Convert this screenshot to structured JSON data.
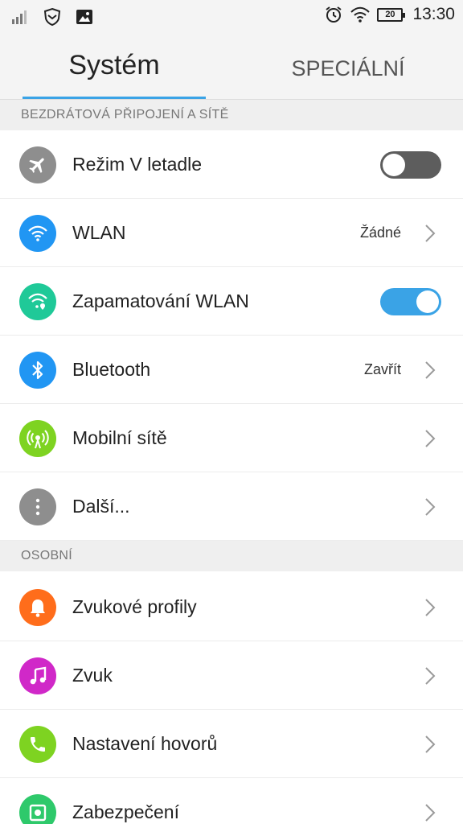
{
  "status_bar": {
    "time": "13:30",
    "battery": "20",
    "icons": [
      "signal-icon",
      "shield-icon",
      "image-icon",
      "alarm-icon",
      "wifi-icon",
      "battery-icon"
    ]
  },
  "tabs": [
    {
      "label": "Systém",
      "active": true
    },
    {
      "label": "SPECIÁLNÍ",
      "active": false
    }
  ],
  "sections": [
    {
      "title": "BEZDRÁTOVÁ PŘIPOJENÍ A SÍTĚ",
      "items": [
        {
          "label": "Režim V letadle",
          "icon": "airplane-icon",
          "icon_color": "#8e8e8e",
          "control": "toggle",
          "toggle_on": false
        },
        {
          "label": "WLAN",
          "icon": "wifi-icon",
          "icon_color": "#2196f3",
          "control": "chevron",
          "value": "Žádné"
        },
        {
          "label": "Zapamatování WLAN",
          "icon": "wifi-location-icon",
          "icon_color": "#1fc998",
          "control": "toggle",
          "toggle_on": true
        },
        {
          "label": "Bluetooth",
          "icon": "bluetooth-icon",
          "icon_color": "#2196f3",
          "control": "chevron",
          "value": "Zavřít"
        },
        {
          "label": "Mobilní sítě",
          "icon": "antenna-icon",
          "icon_color": "#7ed321",
          "control": "chevron"
        },
        {
          "label": "Další...",
          "icon": "more-icon",
          "icon_color": "#8e8e8e",
          "control": "chevron"
        }
      ]
    },
    {
      "title": "OSOBNÍ",
      "items": [
        {
          "label": "Zvukové profily",
          "icon": "bell-icon",
          "icon_color": "#ff6d1b",
          "control": "chevron"
        },
        {
          "label": "Zvuk",
          "icon": "music-icon",
          "icon_color": "#d028c8",
          "control": "chevron"
        },
        {
          "label": "Nastavení hovorů",
          "icon": "phone-icon",
          "icon_color": "#7ed321",
          "control": "chevron"
        },
        {
          "label": "Zabezpečení",
          "icon": "security-icon",
          "icon_color": "#2ec96b",
          "control": "chevron"
        }
      ]
    }
  ]
}
